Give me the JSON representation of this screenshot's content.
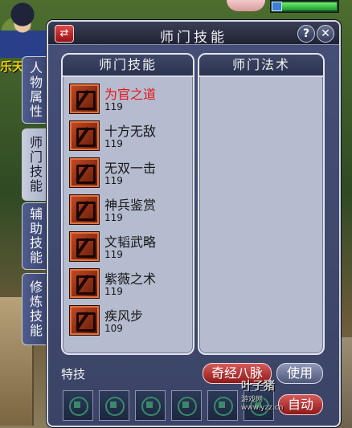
{
  "panel": {
    "title": "师门技能",
    "help_label": "?",
    "close_label": "✕",
    "swap_label": "⇄"
  },
  "character": {
    "name_fragment": "乐天"
  },
  "side_tabs": [
    {
      "label": "人物属性",
      "active": false
    },
    {
      "label": "师门技能",
      "active": true
    },
    {
      "label": "辅助技能",
      "active": false
    },
    {
      "label": "修炼技能",
      "active": false
    }
  ],
  "left_box": {
    "header": "师门技能",
    "skills": [
      {
        "name": "为官之道",
        "level": "119",
        "selected": true,
        "icon": "seal-icon"
      },
      {
        "name": "十方无敌",
        "level": "119",
        "selected": false,
        "icon": "crossed-swords-icon"
      },
      {
        "name": "无双一击",
        "level": "119",
        "selected": false,
        "icon": "strike-icon"
      },
      {
        "name": "神兵鉴赏",
        "level": "119",
        "selected": false,
        "icon": "weapon-icon"
      },
      {
        "name": "文韬武略",
        "level": "119",
        "selected": false,
        "icon": "scroll-icon"
      },
      {
        "name": "紫薇之术",
        "level": "119",
        "selected": false,
        "icon": "star-icon"
      },
      {
        "name": "疾风步",
        "level": "109",
        "selected": false,
        "icon": "wind-step-icon"
      }
    ]
  },
  "right_box": {
    "header": "师门法术",
    "items": []
  },
  "special": {
    "label": "特技",
    "qijing_button": "奇经八脉",
    "use_button": "使用",
    "auto_button": "自动",
    "slot_count": 6
  },
  "watermark": {
    "main": "叶子猪",
    "sub": "游戏网",
    "url": "www.yzz.cn"
  },
  "colors": {
    "selected_skill": "#e8141a",
    "panel_bg": "#454f77",
    "list_bg": "#b5bccf"
  }
}
